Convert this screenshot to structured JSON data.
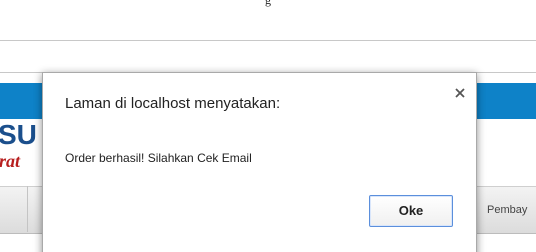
{
  "caption": {
    "text": "g"
  },
  "site": {
    "logo_top": "SU",
    "logo_bottom": "rat",
    "nav": {
      "item_partial": "Pembay"
    }
  },
  "dialog": {
    "title": "Laman di localhost menyatakan:",
    "message": "Order berhasil! Silahkan Cek Email",
    "ok_label": "Oke",
    "close_icon": "close-icon"
  },
  "colors": {
    "blue_bar": "#0e82c8",
    "logo_blue": "#1b4f8c",
    "logo_red": "#b71e1e",
    "button_border": "#5b8fdc"
  }
}
